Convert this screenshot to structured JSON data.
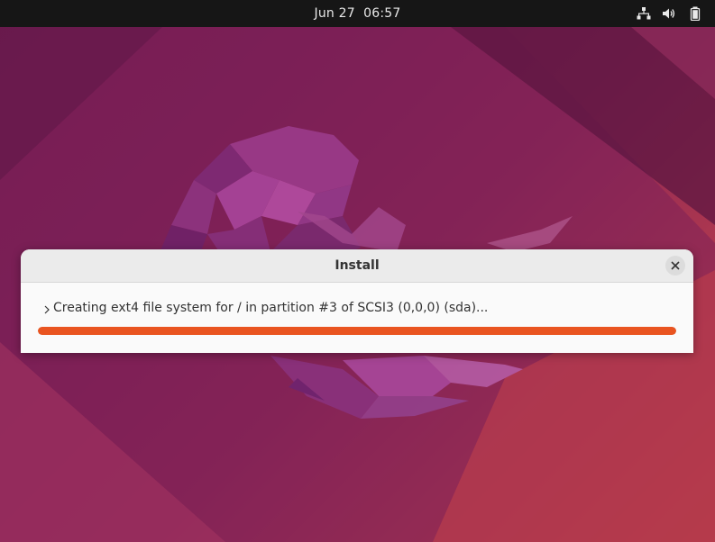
{
  "topbar": {
    "date": "Jun 27",
    "time": "06:57",
    "icons": [
      "network-wired-icon",
      "volume-icon",
      "battery-icon"
    ]
  },
  "dialog": {
    "title": "Install",
    "status_text": "Creating ext4 file system for / in partition #3 of SCSI3 (0,0,0) (sda)...",
    "progress": 1.0,
    "close_icon": "close-icon",
    "expander_icon": "chevron-right-icon"
  },
  "colors": {
    "accent": "#e95420",
    "topbar_bg": "#161616",
    "dialog_bg": "#fafafa"
  }
}
